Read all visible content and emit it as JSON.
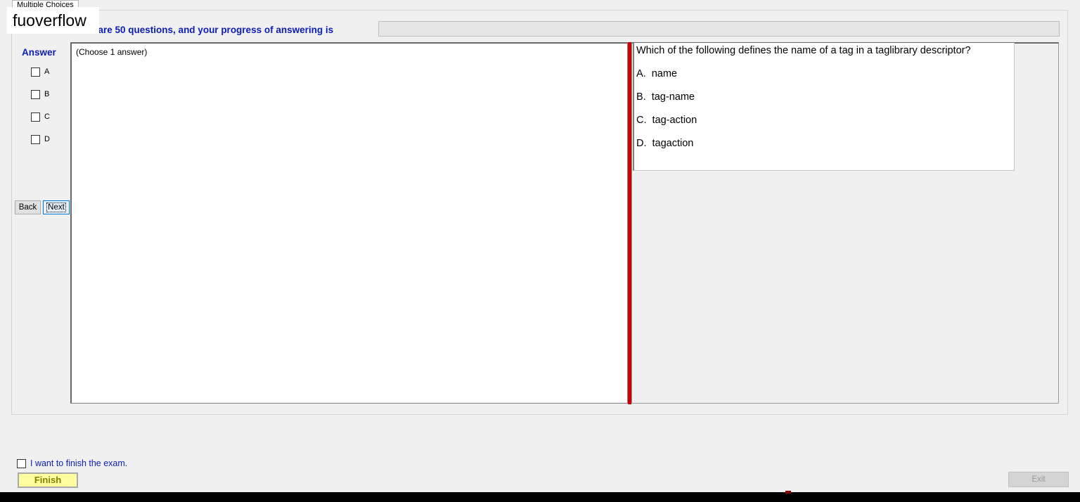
{
  "watermark": "fuoverflow",
  "tab": {
    "label": "Multiple Choices"
  },
  "progress": {
    "label": "There are 50 questions, and your progress of answering is",
    "value_fraction": 0
  },
  "answer": {
    "heading": "Answer",
    "options": [
      "A",
      "B",
      "C",
      "D"
    ],
    "hint": "(Choose 1 answer)"
  },
  "nav": {
    "back_label": "Back",
    "next_label": "Next"
  },
  "question": {
    "text": "Which of the following defines the name of a tag in a taglibrary descriptor?",
    "choices": [
      {
        "letter": "A.",
        "text": "name"
      },
      {
        "letter": "B.",
        "text": "tag-name"
      },
      {
        "letter": "C.",
        "text": "tag-action"
      },
      {
        "letter": "D.",
        "text": "tagaction"
      }
    ]
  },
  "footer": {
    "finish_check_label": "I want to finish the exam.",
    "finish_label": "Finish",
    "exit_label": "Exit"
  },
  "colors": {
    "accent_text": "#0a1eb4",
    "splitter": "#cc0000",
    "finish_bg": "#ffffa0"
  }
}
